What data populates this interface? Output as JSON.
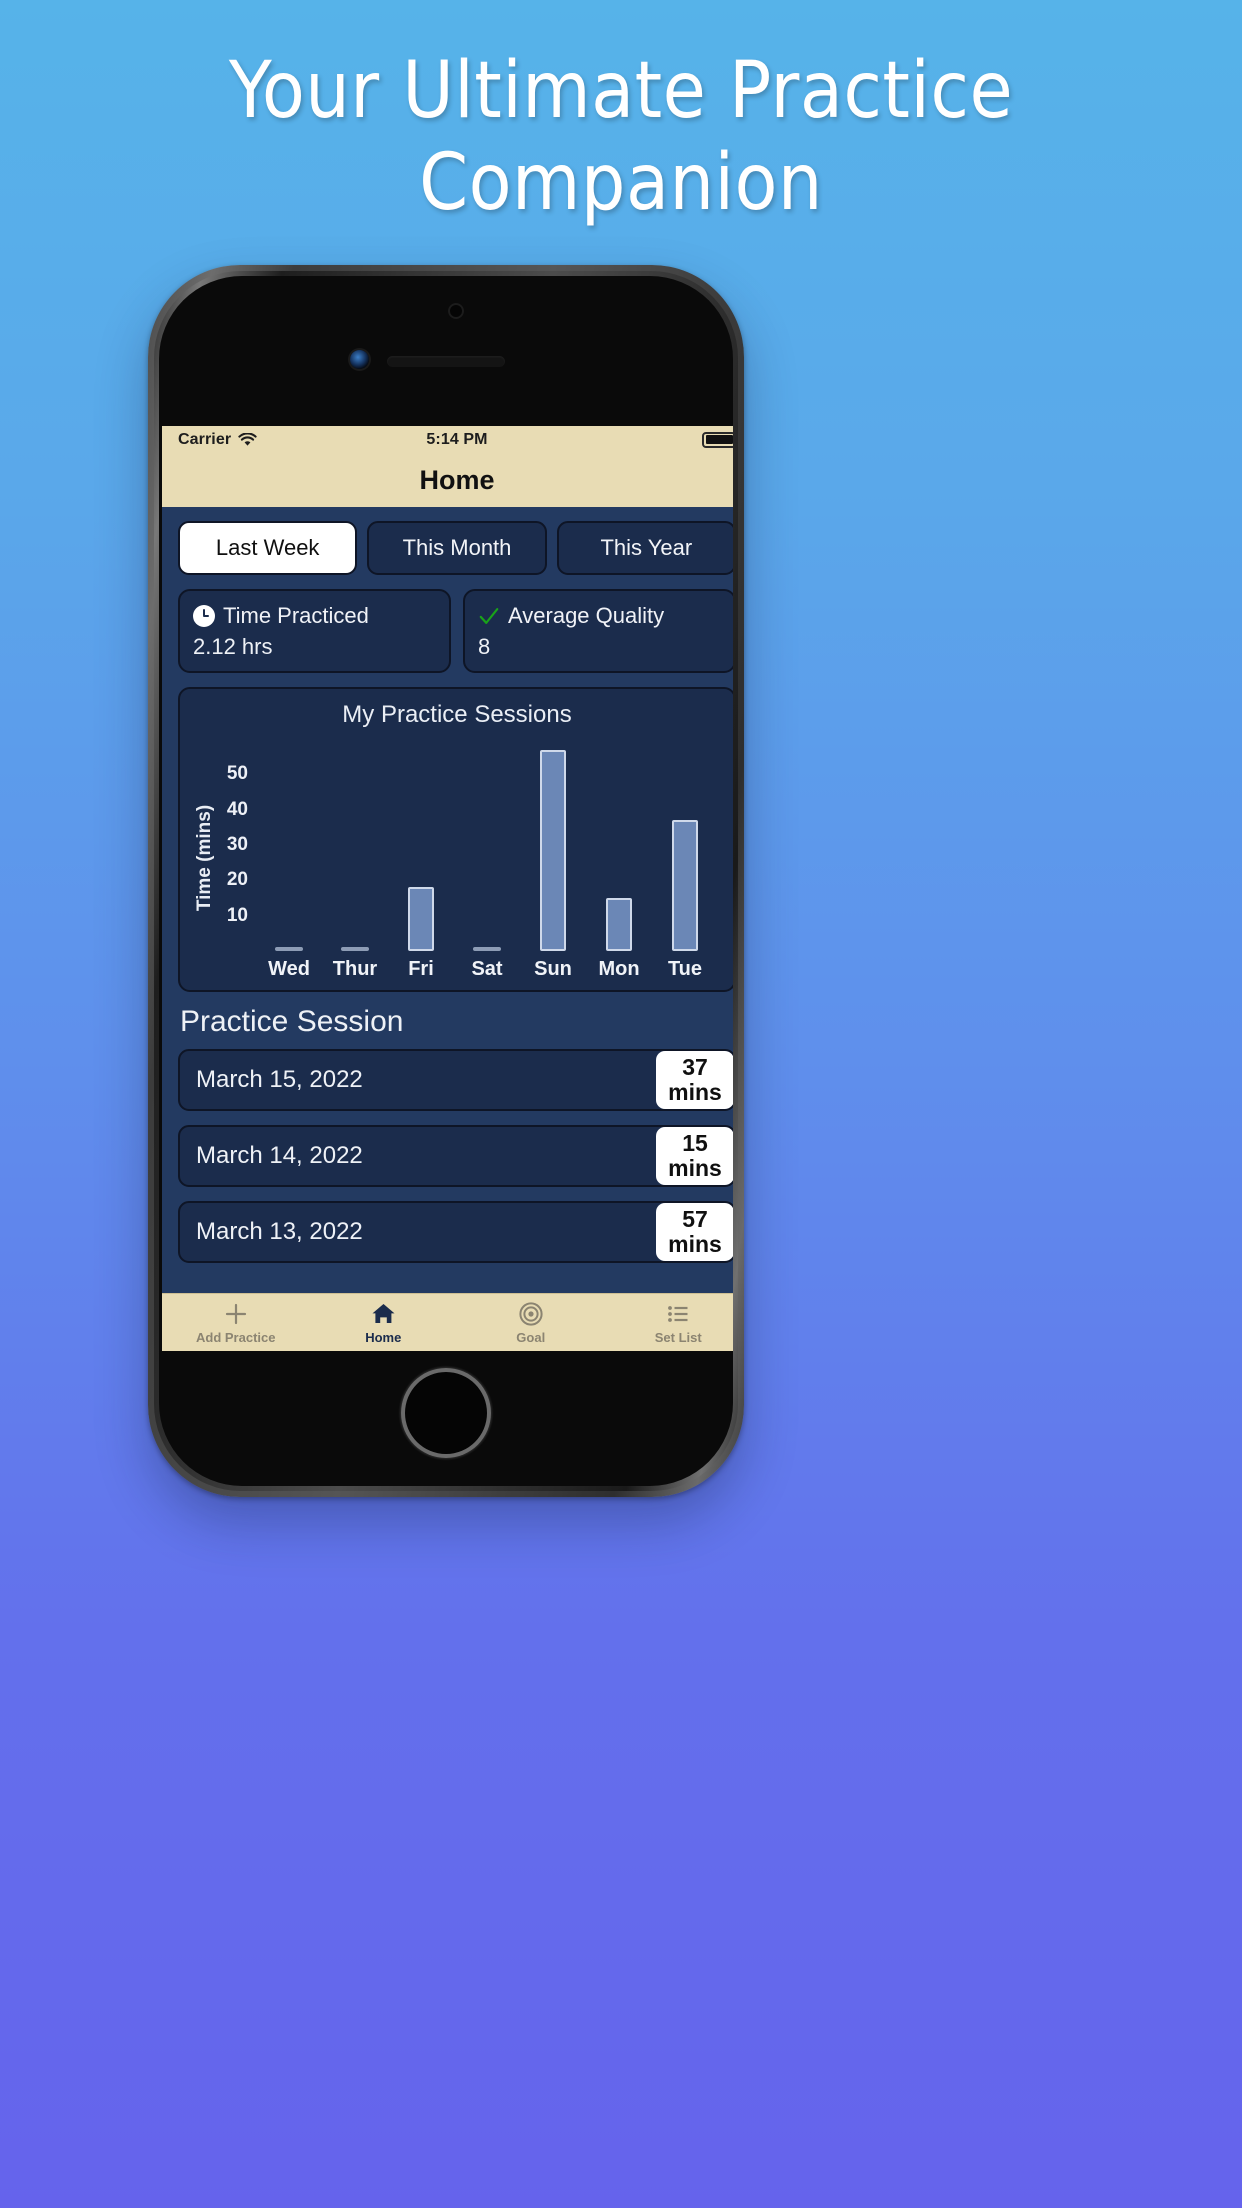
{
  "promo": {
    "headline_line1": "Your Ultimate Practice",
    "headline_line2": "Companion",
    "background_top": "#56b3e9",
    "background_bottom": "#6563ec"
  },
  "statusbar": {
    "carrier": "Carrier",
    "wifi_icon": "wifi-icon",
    "time": "5:14 PM",
    "battery_icon": "battery-full-icon"
  },
  "navbar": {
    "title": "Home"
  },
  "segments": {
    "options": [
      {
        "label": "Last Week",
        "selected": true
      },
      {
        "label": "This Month",
        "selected": false
      },
      {
        "label": "This Year",
        "selected": false
      }
    ]
  },
  "stats": [
    {
      "icon": "clock-icon",
      "title": "Time Practiced",
      "value": "2.12 hrs"
    },
    {
      "icon": "check-icon",
      "title": "Average Quality",
      "value": "8",
      "icon_color": "#19a319"
    }
  ],
  "chart_data": {
    "type": "bar",
    "title": "My Practice Sessions",
    "xlabel": "",
    "ylabel": "Time (mins)",
    "categories": [
      "Wed",
      "Thur",
      "Fri",
      "Sat",
      "Sun",
      "Mon",
      "Tue"
    ],
    "values": [
      0,
      0,
      18,
      0,
      57,
      15,
      37
    ],
    "ylim": [
      0,
      57
    ],
    "yticks": [
      10,
      20,
      30,
      40,
      50
    ],
    "grid": false,
    "legend": "none",
    "bar_color": "#6b87b6",
    "bar_border_color": "#cfd9ea"
  },
  "sessions": {
    "section_title": "Practice Session",
    "unit_label": "mins",
    "rows": [
      {
        "date": "March 15, 2022",
        "minutes": "37",
        "unit": "mins"
      },
      {
        "date": "March 14, 2022",
        "minutes": "15",
        "unit": "mins"
      },
      {
        "date": "March 13, 2022",
        "minutes": "57",
        "unit": "mins"
      }
    ]
  },
  "tabbar": {
    "tabs": [
      {
        "label": "Add Practice",
        "icon": "plus-icon",
        "active": false
      },
      {
        "label": "Home",
        "icon": "home-icon",
        "active": true
      },
      {
        "label": "Goal",
        "icon": "target-icon",
        "active": false
      },
      {
        "label": "Set List",
        "icon": "list-icon",
        "active": false
      }
    ]
  }
}
